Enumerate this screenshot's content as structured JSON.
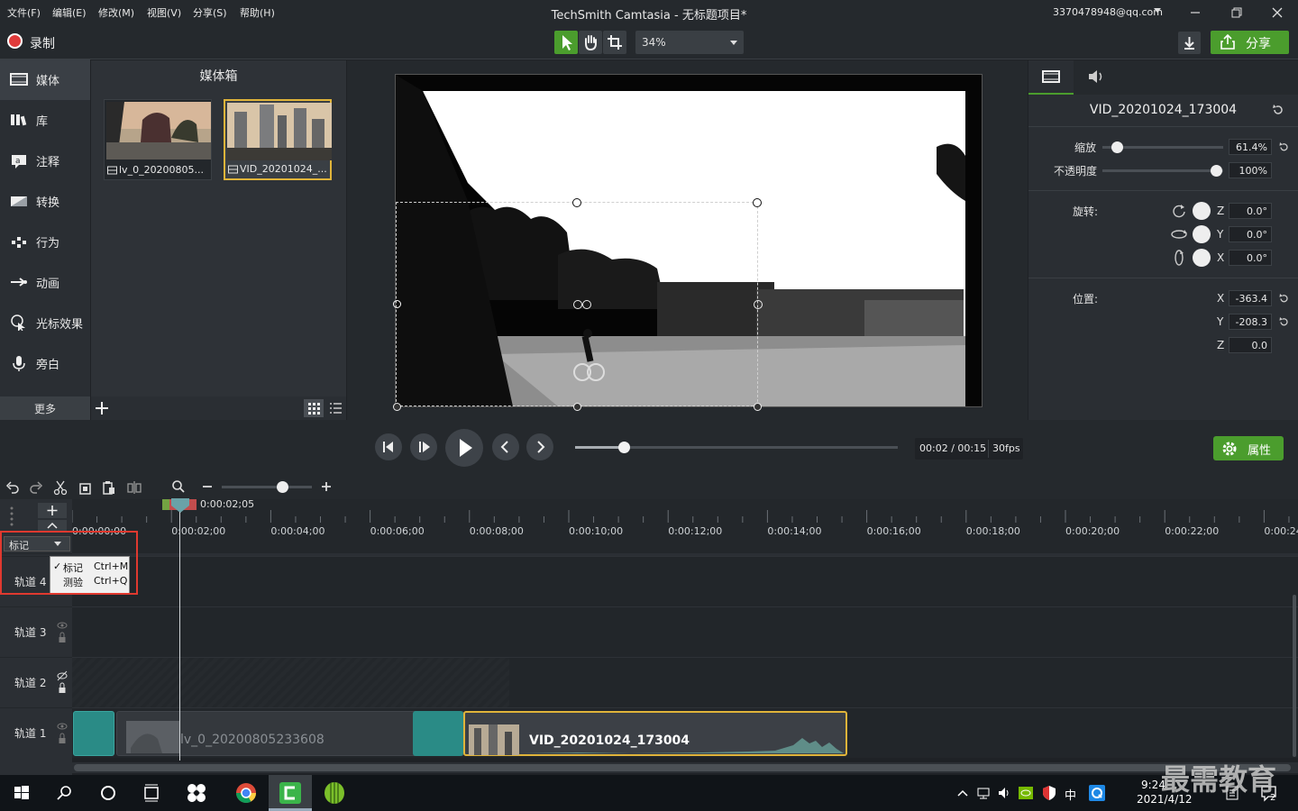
{
  "menu": [
    "文件(F)",
    "编辑(E)",
    "修改(M)",
    "视图(V)",
    "分享(S)",
    "帮助(H)"
  ],
  "window": {
    "title": "TechSmith Camtasia - 无标题项目*",
    "account": "3370478948@qq.com"
  },
  "toolbar": {
    "record_label": "录制",
    "zoom": "34%",
    "share_label": "分享"
  },
  "leftnav": {
    "items": [
      {
        "label": "媒体",
        "icon": "film-icon"
      },
      {
        "label": "库",
        "icon": "library-icon"
      },
      {
        "label": "注释",
        "icon": "annotation-icon"
      },
      {
        "label": "转换",
        "icon": "transition-icon"
      },
      {
        "label": "行为",
        "icon": "behavior-icon"
      },
      {
        "label": "动画",
        "icon": "animation-icon"
      },
      {
        "label": "光标效果",
        "icon": "cursor-effect-icon"
      },
      {
        "label": "旁白",
        "icon": "microphone-icon"
      }
    ],
    "more_label": "更多"
  },
  "mediabin": {
    "title": "媒体箱",
    "items": [
      {
        "label": "lv_0_20200805..."
      },
      {
        "label": "VID_20201024_..."
      }
    ]
  },
  "properties": {
    "clip_name": "VID_20201024_173004",
    "scale_label": "缩放",
    "scale_value": "61.4%",
    "scale_level": 0.12,
    "opacity_label": "不透明度",
    "opacity_value": "100%",
    "opacity_level": 1.0,
    "rotation_label": "旋转:",
    "rotation": [
      {
        "axis": "Z",
        "value": "0.0°"
      },
      {
        "axis": "Y",
        "value": "0.0°"
      },
      {
        "axis": "X",
        "value": "0.0°"
      }
    ],
    "position_label": "位置:",
    "position": [
      {
        "axis": "X",
        "value": "-363.4"
      },
      {
        "axis": "Y",
        "value": "-208.3"
      },
      {
        "axis": "Z",
        "value": "0.0"
      }
    ]
  },
  "playback": {
    "time": "00:02 / 00:15",
    "fps": "30fps",
    "progress": 0.15,
    "attr_label": "属性"
  },
  "timeline": {
    "playhead_time": "0:00:02;05",
    "ticks": [
      "0:00:00;00",
      "0:00:02;00",
      "0:00:04;00",
      "0:00:06;00",
      "0:00:08;00",
      "0:00:10;00",
      "0:00:12;00",
      "0:00:14;00",
      "0:00:16;00",
      "0:00:18;00",
      "0:00:20;00",
      "0:00:22;00",
      "0:00:24"
    ],
    "marker_select": "标记",
    "context_menu": [
      {
        "label": "标记",
        "shortcut": "Ctrl+M",
        "checked": true
      },
      {
        "label": "测验",
        "shortcut": "Ctrl+Q",
        "checked": false
      }
    ],
    "tracks": [
      "轨道 4",
      "轨道 3",
      "轨道 2",
      "轨道 1"
    ],
    "clips": {
      "clip1_name": "lv_0_20200805233608",
      "clip2_name": "VID_20201024_173004"
    }
  },
  "taskbar": {
    "time": "9:24",
    "date": "2021/4/12",
    "ime": "中",
    "notification_count": "2"
  },
  "watermark": "最需教育",
  "colors": {
    "accent_green": "#4b9d2d",
    "selection_yellow": "#e0b43a",
    "record_red": "#e03b3b",
    "teal_clip": "#2a8b86"
  }
}
